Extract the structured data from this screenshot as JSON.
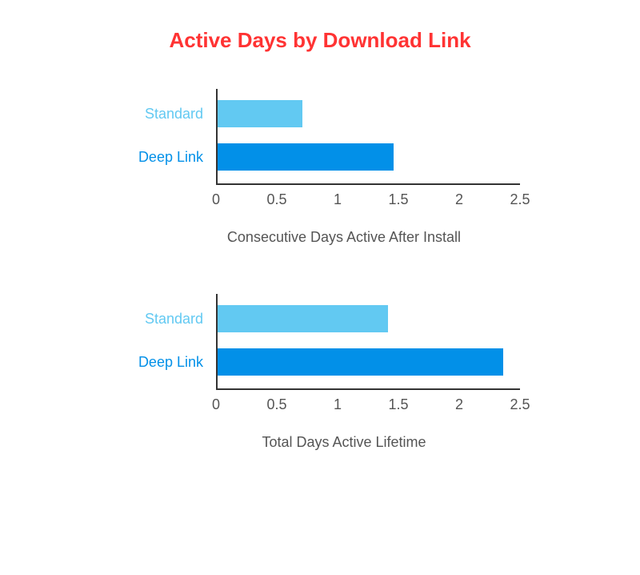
{
  "title": "Active Days by Download Link",
  "chart_data": [
    {
      "type": "bar",
      "orientation": "horizontal",
      "title": "Consecutive Days Active After Install",
      "categories": [
        "Standard",
        "Deep Link"
      ],
      "values": [
        0.7,
        1.45
      ],
      "xlabel": "",
      "ylabel": "",
      "xlim": [
        0,
        2.5
      ],
      "x_ticks": [
        0,
        0.5,
        1,
        1.5,
        2,
        2.5
      ],
      "colors": {
        "Standard": "#62c9f2",
        "Deep Link": "#0290e8"
      }
    },
    {
      "type": "bar",
      "orientation": "horizontal",
      "title": "Total Days Active Lifetime",
      "categories": [
        "Standard",
        "Deep Link"
      ],
      "values": [
        1.4,
        2.35
      ],
      "xlabel": "",
      "ylabel": "",
      "xlim": [
        0,
        2.5
      ],
      "x_ticks": [
        0,
        0.5,
        1,
        1.5,
        2,
        2.5
      ],
      "colors": {
        "Standard": "#62c9f2",
        "Deep Link": "#0290e8"
      }
    }
  ],
  "tick_labels": {
    "t0": "0",
    "t1": "0.5",
    "t2": "1",
    "t3": "1.5",
    "t4": "2",
    "t5": "2.5"
  }
}
